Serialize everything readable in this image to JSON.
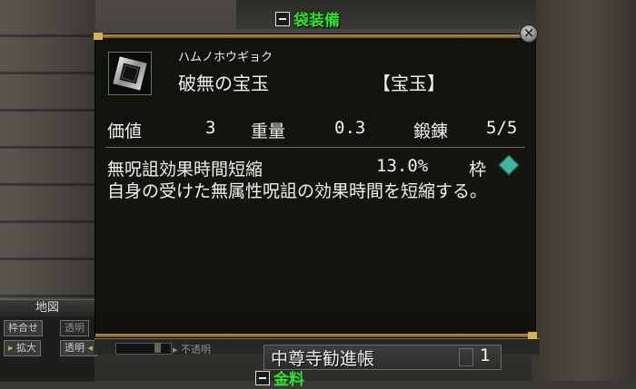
{
  "header": {
    "section_tag": "袋装備"
  },
  "item": {
    "reading": "ハムノホウギョク",
    "name": "破無の宝玉",
    "category": "【宝玉】",
    "stats": {
      "value_label": "価値",
      "value": "3",
      "weight_label": "重量",
      "weight": "0.3",
      "forge_label": "鍛錬",
      "forge": "5/5"
    },
    "effect": {
      "name": "無呪詛効果時間短縮",
      "value": "13.0%",
      "slot_label": "枠"
    },
    "description": "自身の受けた無属性呪詛の効果時間を短縮する。"
  },
  "map_panel": {
    "title": "地図",
    "fit_button": "枠合せ",
    "transparent_button": "透明",
    "zoom_button": "拡大",
    "transparent_mode": "透明",
    "opaque_label": "不透明"
  },
  "list": {
    "row_label": "中尊寺勧進帳",
    "row_count": "1",
    "bottom_tag": "金料"
  },
  "colors": {
    "section_green": "#27e82a",
    "frame_gold": "#b99648",
    "slot_teal": "#3fb8a3"
  },
  "icons": {
    "close": "close-icon",
    "slot": "diamond-slot-icon",
    "item": "gem-frame-icon"
  }
}
